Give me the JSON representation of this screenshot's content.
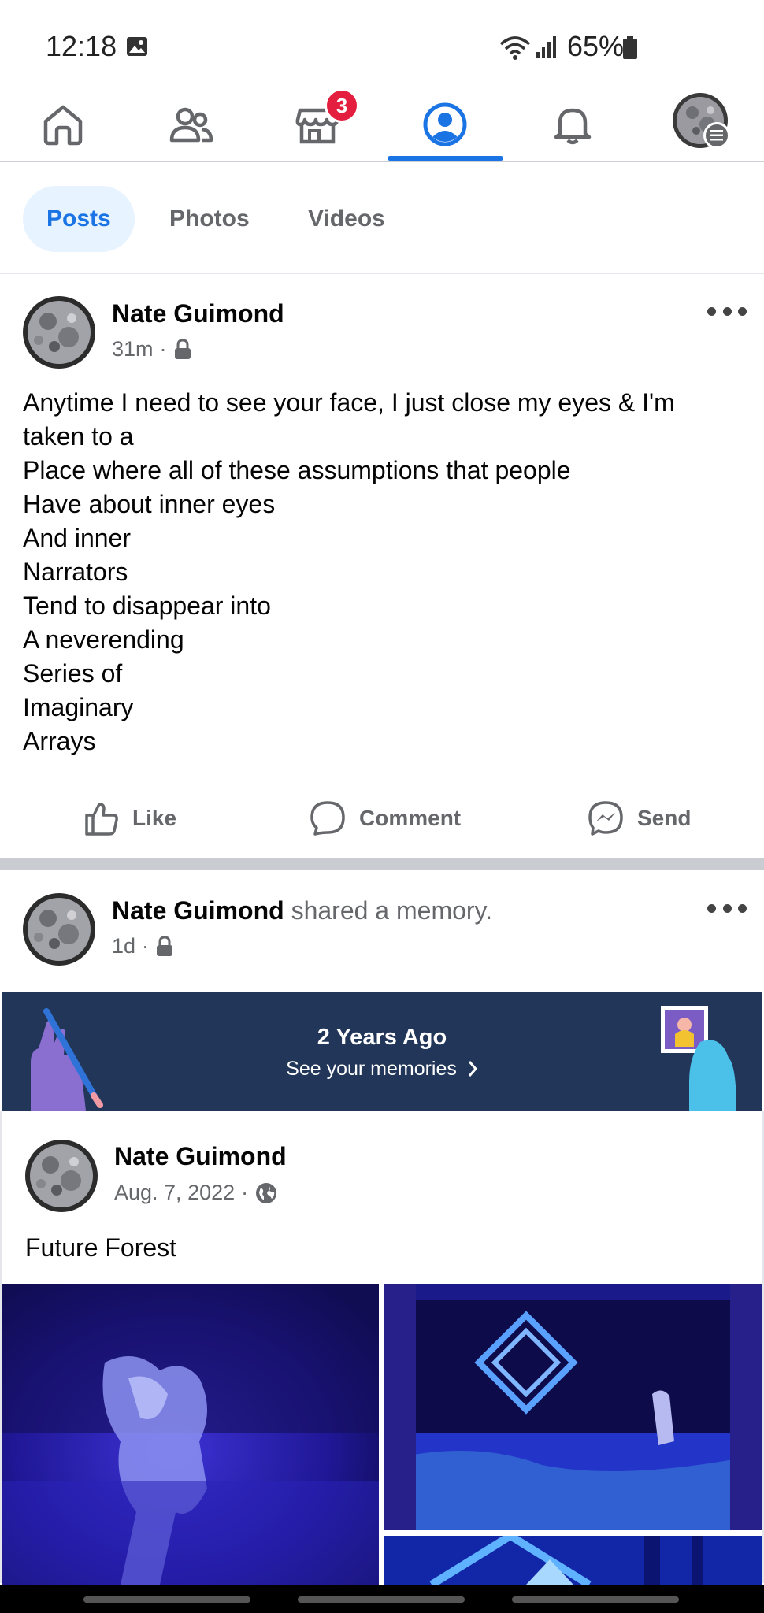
{
  "status_bar": {
    "time": "12:18",
    "battery": "65%"
  },
  "nav": {
    "marketplace_badge": "3",
    "accent": "#1b74e4",
    "items": [
      "home-icon",
      "friends-icon",
      "marketplace-icon",
      "profile-icon",
      "notifications-icon",
      "menu-avatar"
    ]
  },
  "tabs": {
    "items": [
      {
        "label": "Posts"
      },
      {
        "label": "Photos"
      },
      {
        "label": "Videos"
      }
    ]
  },
  "post1": {
    "author": "Nate Guimond",
    "time": "31m",
    "separator": "·",
    "body": [
      "Anytime I need to see your face, I just close my eyes & I'm",
      "taken to a",
      "Place where all of these assumptions that people",
      "Have about inner eyes",
      "And inner",
      "Narrators",
      "Tend to disappear into",
      "A neverending",
      "Series of",
      "Imaginary",
      "Arrays"
    ],
    "actions": {
      "like": "Like",
      "comment": "Comment",
      "send": "Send"
    }
  },
  "post2": {
    "author": "Nate Guimond",
    "activity": "shared a memory.",
    "time": "1d",
    "separator": "·",
    "memory": {
      "title": "2 Years Ago",
      "link": "See your memories",
      "background": "#213658"
    },
    "shared": {
      "author": "Nate Guimond",
      "date": "Aug. 7, 2022",
      "separator": "·",
      "text": "Future Forest"
    }
  }
}
